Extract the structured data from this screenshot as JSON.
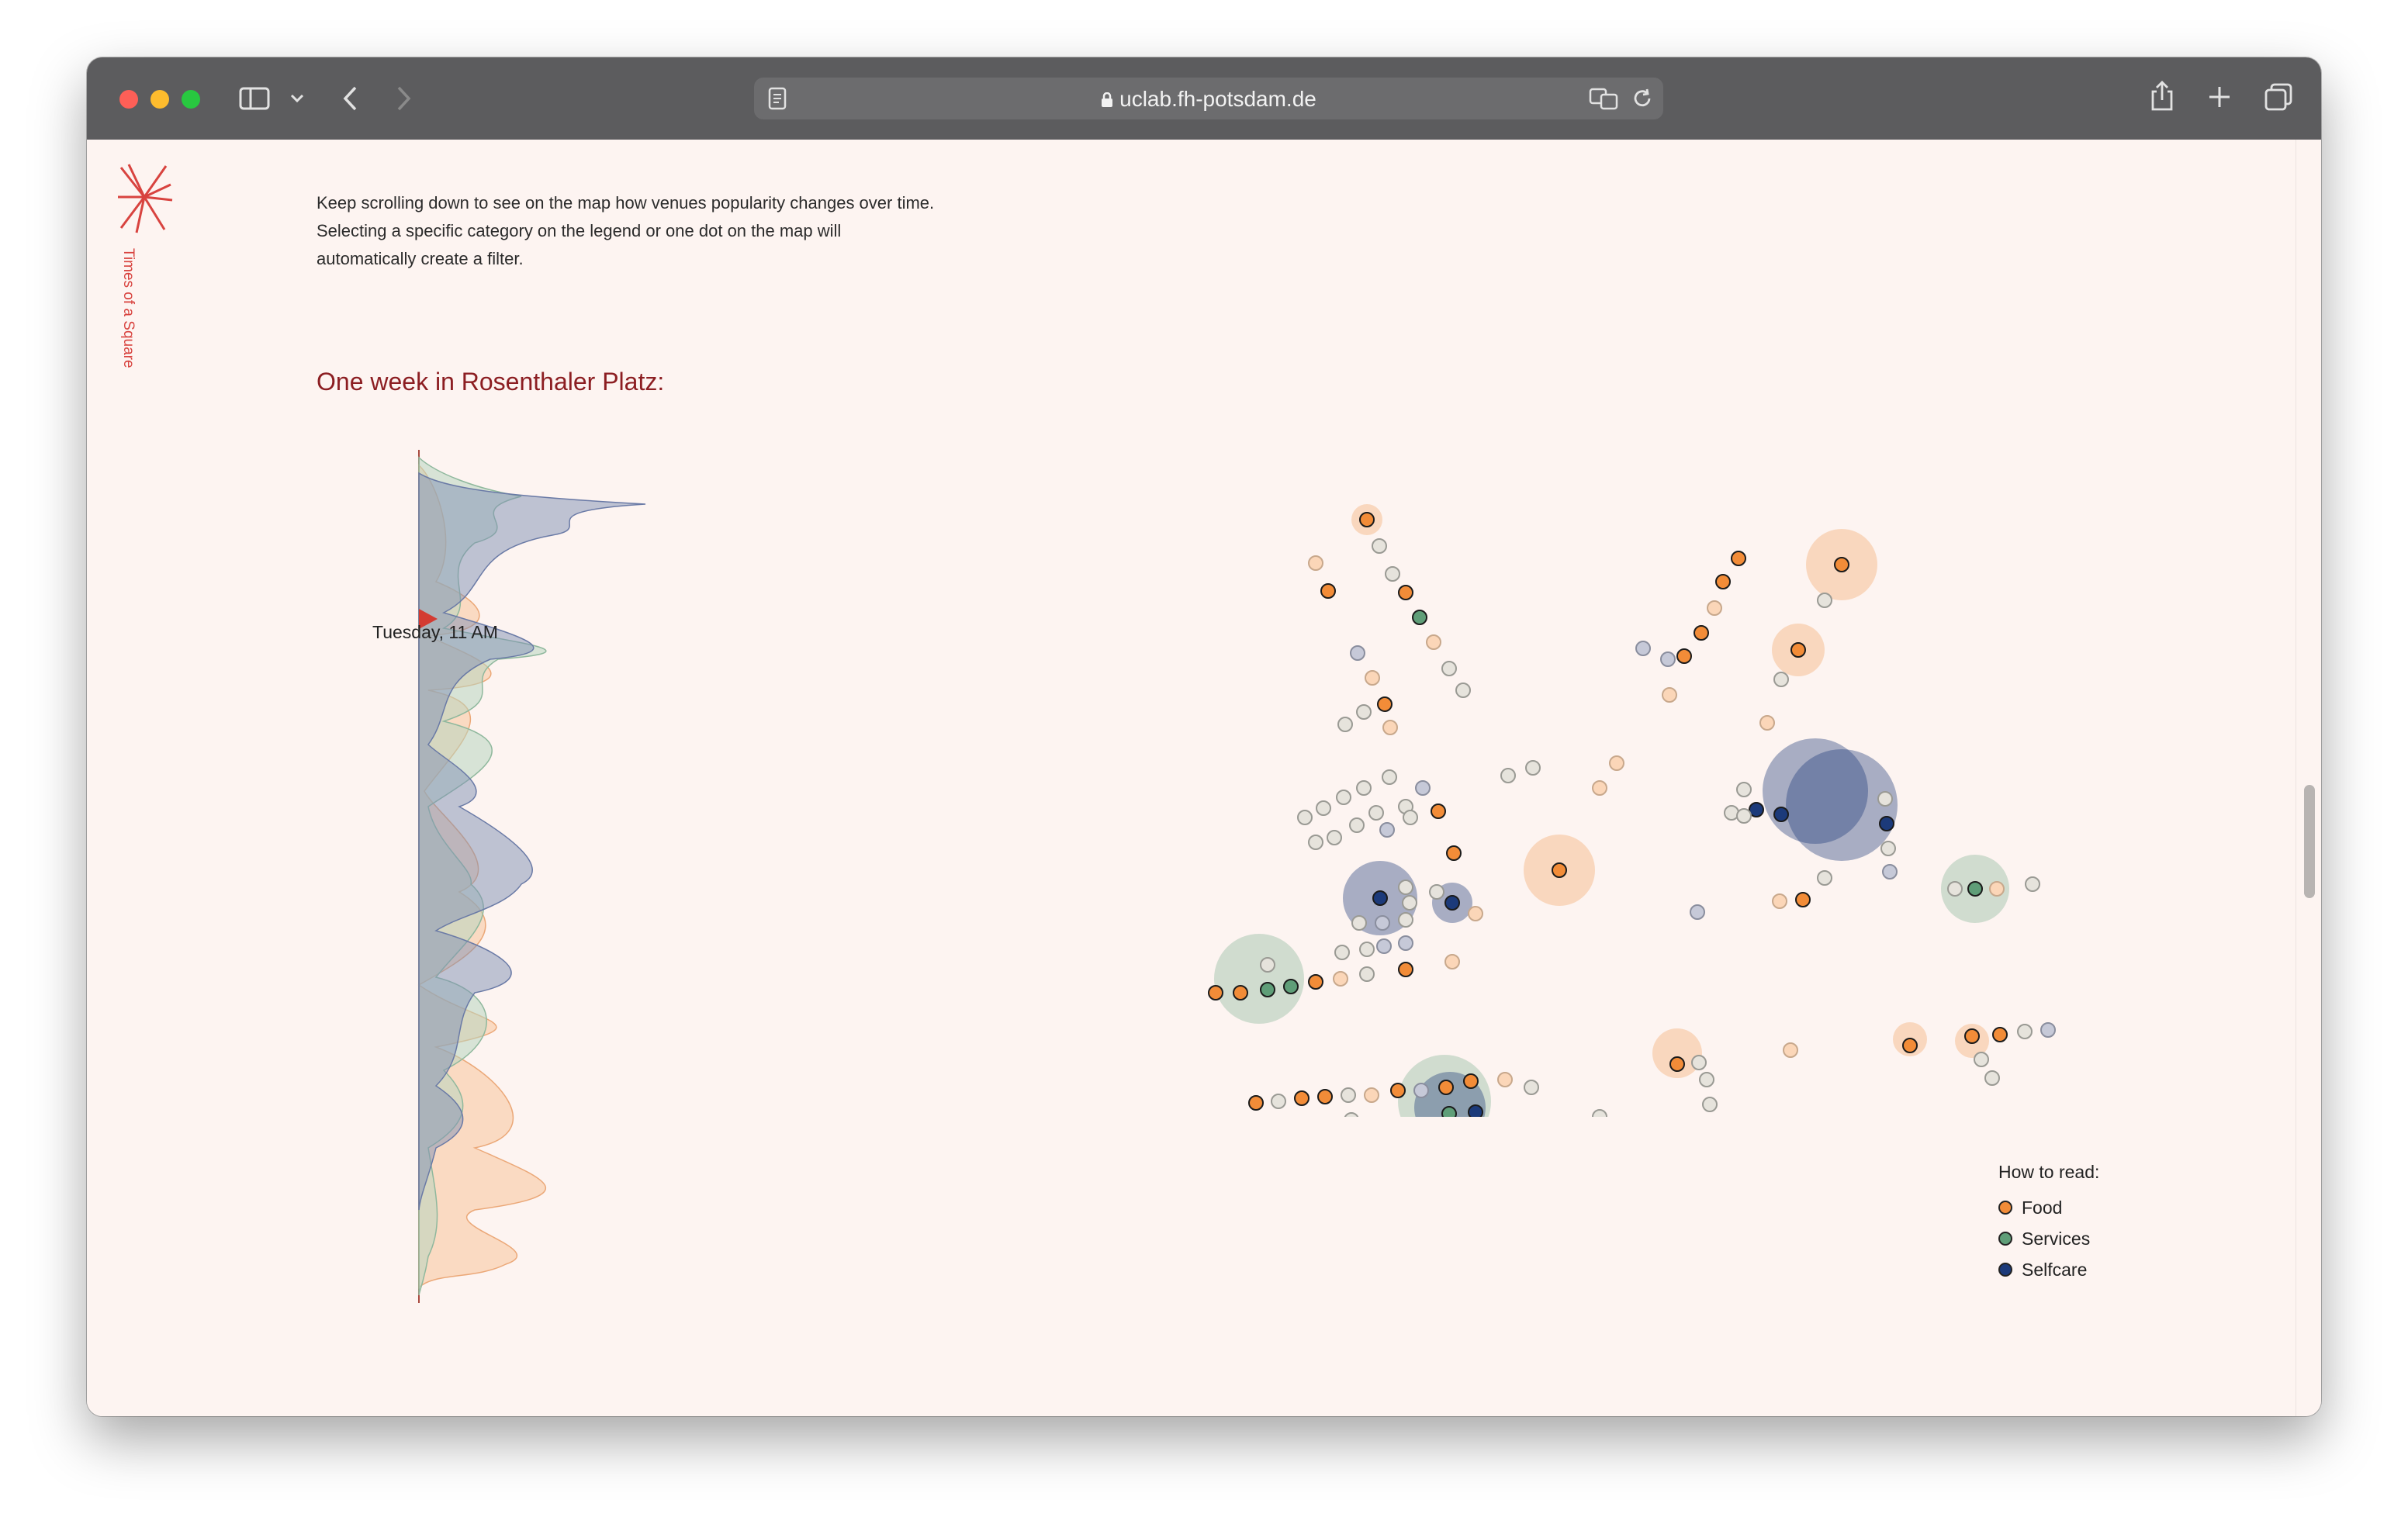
{
  "browser": {
    "url": "uclab.fh-potsdam.de"
  },
  "site": {
    "logo_text": "Times of a Square"
  },
  "page": {
    "intro": "Keep scrolling down to see on the map how venues popularity changes over time. Selecting a specific category on the legend or one dot on the map will automatically create a filter.",
    "heading": "One week in Rosenthaler Platz:",
    "time_marker": "Tuesday, 11 AM"
  },
  "legend": {
    "title": "How to read:",
    "items": [
      {
        "label": "Food",
        "color": "#f28c38"
      },
      {
        "label": "Services",
        "color": "#5f9e78"
      },
      {
        "label": "Selfcare",
        "color": "#1c3a7a"
      }
    ]
  },
  "colors": {
    "food": "#f28c38",
    "services": "#5f9e78",
    "selfcare": "#1c3a7a",
    "inactive": "#d6d6d0",
    "heading": "#8c1e22",
    "accent": "#d8433f"
  }
}
